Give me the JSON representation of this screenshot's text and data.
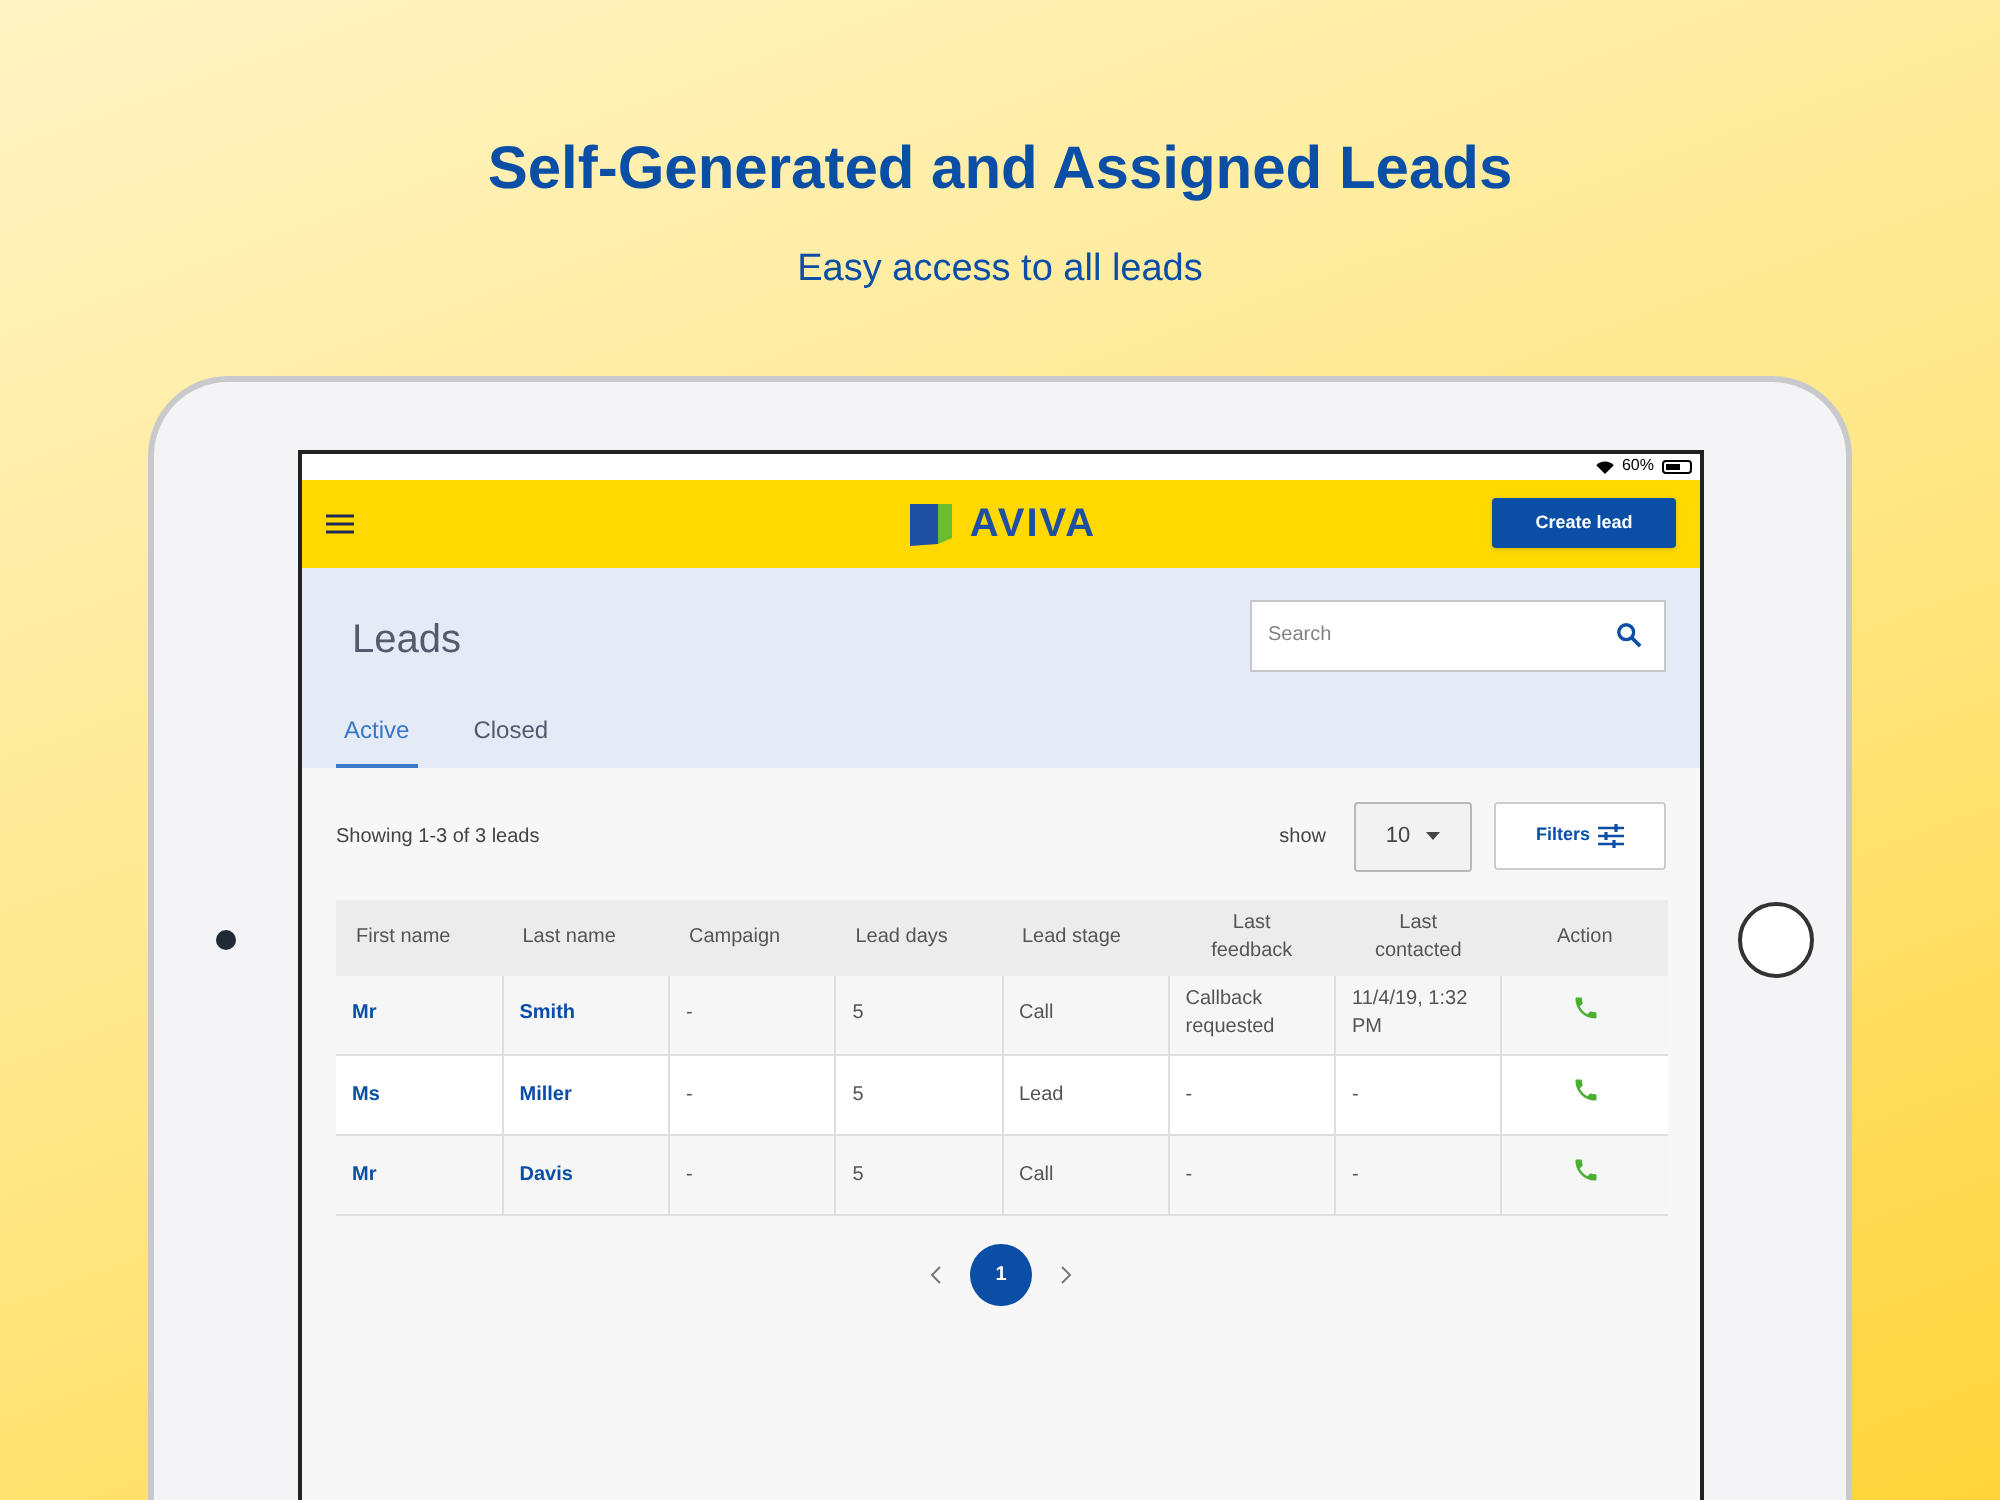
{
  "headline": "Self-Generated and Assigned Leads",
  "subheadline": "Easy access to all leads",
  "status_bar": {
    "battery_text": "60%"
  },
  "app_header": {
    "logo_text": "AVIVA",
    "button": "Create lead"
  },
  "page_title": "Leads",
  "search": {
    "placeholder": "Search"
  },
  "tabs": [
    {
      "label": "Active",
      "selected": true
    },
    {
      "label": "Closed",
      "selected": false
    }
  ],
  "summary": "Showing 1-3 of 3 leads",
  "show_label": "show",
  "page_size": "10",
  "filters_button": "Filters",
  "table": {
    "columns": [
      "First name",
      "Last name",
      "Campaign",
      "Lead days",
      "Lead stage",
      "Last feedback",
      "Last contacted",
      "Action"
    ],
    "rows": [
      {
        "cells": [
          "Mr",
          "Smith",
          "-",
          "5",
          "Call",
          "Callback requested",
          "11/4/19, 1:32 PM"
        ]
      },
      {
        "cells": [
          "Ms",
          "Miller",
          "-",
          "5",
          "Lead",
          "-",
          "-"
        ]
      },
      {
        "cells": [
          "Mr",
          "Davis",
          "-",
          "5",
          "Call",
          "-",
          "-"
        ]
      }
    ]
  },
  "pagination": [
    {
      "label": "1",
      "selected": true
    }
  ]
}
